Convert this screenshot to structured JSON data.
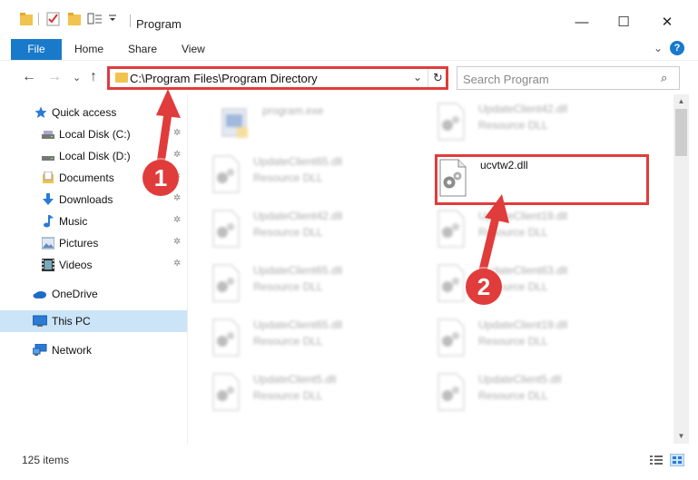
{
  "window": {
    "title": "Program",
    "minimize": "—",
    "maximize": "☐",
    "close": "✕"
  },
  "ribbon": {
    "tabs": [
      "File",
      "Home",
      "Share",
      "View"
    ],
    "expand_chevron": "⌄",
    "help": "?"
  },
  "address": {
    "back": "←",
    "forward": "→",
    "recent": "⌄",
    "up": "↑",
    "path": "C:\\Program Files\\Program Directory",
    "dropdown": "⌄",
    "refresh": "↻"
  },
  "search": {
    "placeholder": "Search Program",
    "icon": "⌕"
  },
  "sidebar": {
    "items": [
      {
        "label": "Quick access",
        "icon": "star-icon"
      },
      {
        "label": "Local Disk (C:)",
        "icon": "drive-icon",
        "pinned": true
      },
      {
        "label": "Local Disk (D:)",
        "icon": "drive-icon",
        "pinned": true
      },
      {
        "label": "Documents",
        "icon": "documents-icon",
        "pinned": true
      },
      {
        "label": "Downloads",
        "icon": "download-icon",
        "pinned": true
      },
      {
        "label": "Music",
        "icon": "music-icon",
        "pinned": true
      },
      {
        "label": "Pictures",
        "icon": "pictures-icon",
        "pinned": true
      },
      {
        "label": "Videos",
        "icon": "videos-icon",
        "pinned": true
      },
      {
        "label": "OneDrive",
        "icon": "cloud-icon"
      },
      {
        "label": "This PC",
        "icon": "computer-icon",
        "selected": true
      },
      {
        "label": "Network",
        "icon": "network-icon"
      }
    ],
    "pin_glyph": "📌"
  },
  "files": {
    "left": [
      {
        "name": "program.exe",
        "type": ""
      },
      {
        "name": "UpdateClient65.dll",
        "type": "Resource DLL"
      },
      {
        "name": "UpdateClient42.dll",
        "type": "Resource DLL"
      },
      {
        "name": "UpdateClient65.dll",
        "type": "Resource DLL"
      },
      {
        "name": "UpdateClient65.dll",
        "type": "Resource DLL"
      },
      {
        "name": "UpdateClient5.dll",
        "type": "Resource DLL"
      }
    ],
    "right": [
      {
        "name": "UpdateClient42.dll",
        "type": "Resource DLL"
      },
      {
        "name": "ucvtw2.dll",
        "type": "",
        "highlighted": true
      },
      {
        "name": "UpdateClient19.dll",
        "type": "Resource DLL"
      },
      {
        "name": "UpdateClient63.dll",
        "type": "Resource DLL"
      },
      {
        "name": "UpdateClient19.dll",
        "type": "Resource DLL"
      },
      {
        "name": "UpdateClient5.dll",
        "type": "Resource DLL"
      }
    ]
  },
  "annotations": {
    "step1": "1",
    "step2": "2",
    "color": "#e03c3c"
  },
  "status": {
    "item_count": "125 items"
  },
  "scrollbar": {
    "up": "▲",
    "down": "▼"
  }
}
